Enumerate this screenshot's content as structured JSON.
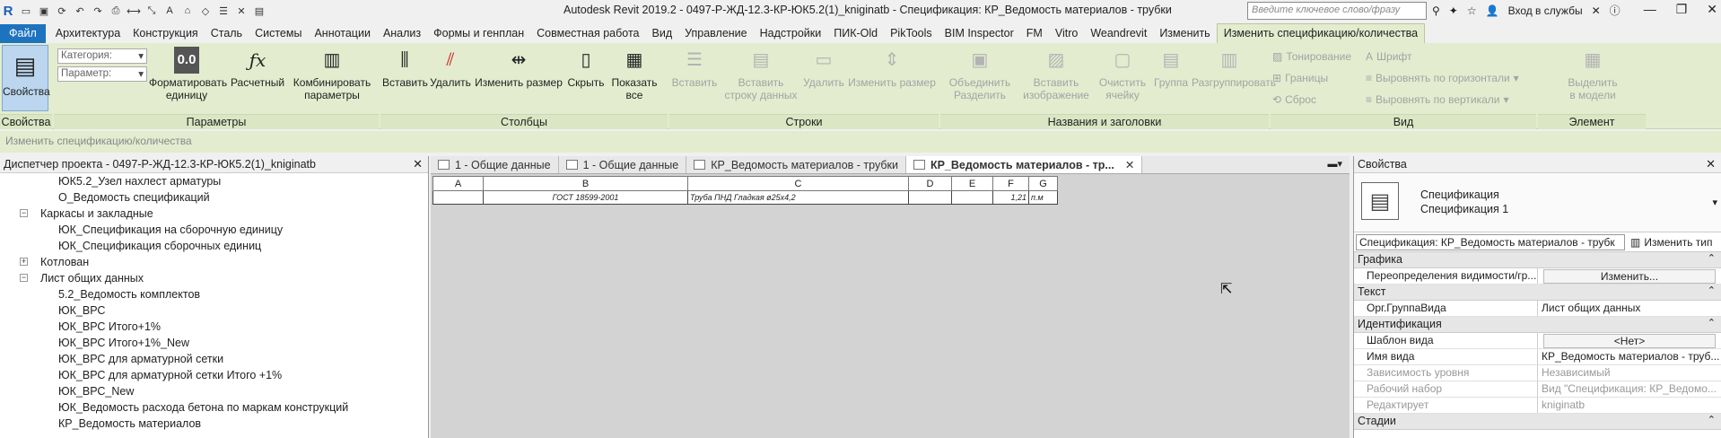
{
  "window": {
    "title": "Autodesk Revit 2019.2 - 0497-Р-ЖД-12.3-КР-ЮК5.2(1)_kniginatb - Спецификация: КР_Ведомость материалов - трубки",
    "search_placeholder": "Введите ключевое слово/фразу",
    "signin": "Вход в службы"
  },
  "menu": {
    "file": "Файл",
    "tabs": [
      "Архитектура",
      "Конструкция",
      "Сталь",
      "Системы",
      "Аннотации",
      "Анализ",
      "Формы и генплан",
      "Совместная работа",
      "Вид",
      "Управление",
      "Надстройки",
      "ПИК-Old",
      "PikTools",
      "BIM Inspector",
      "FM",
      "Vitro",
      "Weandrevit",
      "Изменить"
    ],
    "active_tab": "Изменить спецификацию/количества"
  },
  "ribbon": {
    "properties": {
      "button": "Свойства",
      "group": "Свойства"
    },
    "parameters": {
      "category_label": "Категория:",
      "parameter_label": "Параметр:",
      "format_units": "Форматировать единицу",
      "calculated": "Расчетный",
      "combine_params": "Комбинировать параметры",
      "group": "Параметры"
    },
    "columns": {
      "insert": "Вставить",
      "delete": "Удалить",
      "resize": "Изменить размер",
      "hide": "Скрыть",
      "show_all": "Показать все",
      "group": "Столбцы"
    },
    "rows": {
      "insert": "Вставить",
      "insert_data_row": "Вставить строку данных",
      "delete": "Удалить",
      "resize": "Изменить размер",
      "group": "Строки"
    },
    "titles": {
      "merge": "Объединить Разделить",
      "insert_image": "Вставить изображение",
      "clear_cell": "Очистить ячейку",
      "group_btn": "Группа",
      "ungroup": "Разгруппировать",
      "group": "Названия и заголовки"
    },
    "view": {
      "shading": "Тонирование",
      "borders": "Границы",
      "reset": "Сброс",
      "font": "Шрифт",
      "align_h": "Выровнять по горизонтали",
      "align_v": "Выровнять по вертикали",
      "group": "Вид"
    },
    "element": {
      "highlight": "Выделить в модели",
      "group": "Элемент"
    }
  },
  "options_bar": {
    "text": "Изменить спецификацию/количества"
  },
  "project_browser": {
    "title": "Диспетчер проекта - 0497-Р-ЖД-12.3-КР-ЮК5.2(1)_kniginatb",
    "items": [
      {
        "label": "ЮК5.2_Узел нахлест арматуры",
        "level": 2
      },
      {
        "label": "О_Ведомость спецификаций",
        "level": 2
      },
      {
        "label": "Каркасы и закладные",
        "level": 1,
        "toggle": "−"
      },
      {
        "label": "ЮК_Спецификация на сборочную единицу",
        "level": 2
      },
      {
        "label": "ЮК_Спецификация сборочных единиц",
        "level": 2
      },
      {
        "label": "Котлован",
        "level": 1,
        "toggle": "+"
      },
      {
        "label": "Лист общих данных",
        "level": 1,
        "toggle": "−"
      },
      {
        "label": "5.2_Ведомость комплектов",
        "level": 2
      },
      {
        "label": "ЮК_ВРС",
        "level": 2
      },
      {
        "label": "ЮК_ВРС Итого+1%",
        "level": 2
      },
      {
        "label": "ЮК_ВРС Итого+1%_New",
        "level": 2
      },
      {
        "label": "ЮК_ВРС для арматурной сетки",
        "level": 2
      },
      {
        "label": "ЮК_ВРС для арматурной сетки Итого +1%",
        "level": 2
      },
      {
        "label": "ЮК_ВРС_New",
        "level": 2
      },
      {
        "label": "ЮК_Ведомость расхода бетона по маркам конструкций",
        "level": 2
      },
      {
        "label": "КР_Ведомость материалов",
        "level": 2
      }
    ]
  },
  "view_tabs": [
    {
      "label": "1 - Общие данные",
      "active": false
    },
    {
      "label": "1 - Общие данные",
      "active": false
    },
    {
      "label": "КР_Ведомость материалов - трубки",
      "active": false
    },
    {
      "label": "КР_Ведомость материалов - тр...",
      "active": true
    }
  ],
  "schedule": {
    "headers": [
      "A",
      "B",
      "C",
      "D",
      "E",
      "F",
      "G"
    ],
    "rows": [
      [
        "",
        "ГОСТ 18599-2001",
        "Труба ПНД Гладкая ø25х4,2",
        "",
        "",
        "1,21",
        "п.м"
      ]
    ]
  },
  "properties": {
    "title": "Свойства",
    "type_name_1": "Спецификация",
    "type_name_2": "Спецификация 1",
    "selector": "Спецификация: КР_Ведомость материалов - трубк",
    "edit_type": "Изменить тип",
    "groups": {
      "graphics": "Графика",
      "text": "Текст",
      "identity": "Идентификация",
      "phases": "Стадии"
    },
    "rows": {
      "visibility_key": "Переопределения видимости/гр...",
      "visibility_val": "Изменить...",
      "org_key": "Орг.ГруппаВида",
      "org_val": "Лист общих данных",
      "template_key": "Шаблон вида",
      "template_val": "<Нет>",
      "viewname_key": "Имя вида",
      "viewname_val": "КР_Ведомость материалов - труб...",
      "dependency_key": "Зависимость уровня",
      "dependency_val": "Независимый",
      "workset_key": "Рабочий набор",
      "workset_val": "Вид \"Спецификация: КР_Ведомо...",
      "editedby_key": "Редактирует",
      "editedby_val": "kniginatb"
    }
  }
}
